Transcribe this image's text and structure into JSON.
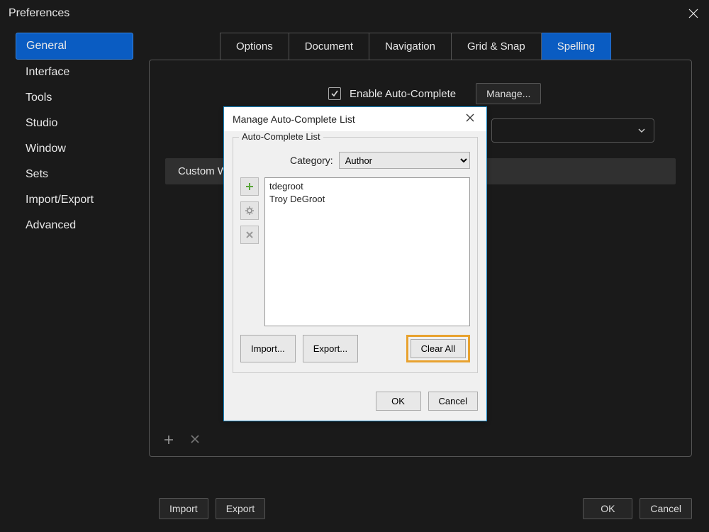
{
  "window": {
    "title": "Preferences"
  },
  "sidebar": {
    "items": [
      {
        "label": "General"
      },
      {
        "label": "Interface"
      },
      {
        "label": "Tools"
      },
      {
        "label": "Studio"
      },
      {
        "label": "Window"
      },
      {
        "label": "Sets"
      },
      {
        "label": "Import/Export"
      },
      {
        "label": "Advanced"
      }
    ]
  },
  "tabs": [
    {
      "label": "Options"
    },
    {
      "label": "Document"
    },
    {
      "label": "Navigation"
    },
    {
      "label": "Grid & Snap"
    },
    {
      "label": "Spelling"
    }
  ],
  "panel": {
    "enable_label": "Enable Auto-Complete",
    "manage_label": "Manage...",
    "tab2": "Custom W",
    "bottom_import": "Import",
    "bottom_export": "Export",
    "ok": "OK",
    "cancel": "Cancel"
  },
  "modal": {
    "title": "Manage Auto-Complete List",
    "group_label": "Auto-Complete List",
    "category_label": "Category:",
    "category_value": "Author",
    "entries": [
      "tdegroot",
      "Troy DeGroot"
    ],
    "import": "Import...",
    "export": "Export...",
    "clear_all": "Clear All",
    "ok": "OK",
    "cancel": "Cancel"
  }
}
